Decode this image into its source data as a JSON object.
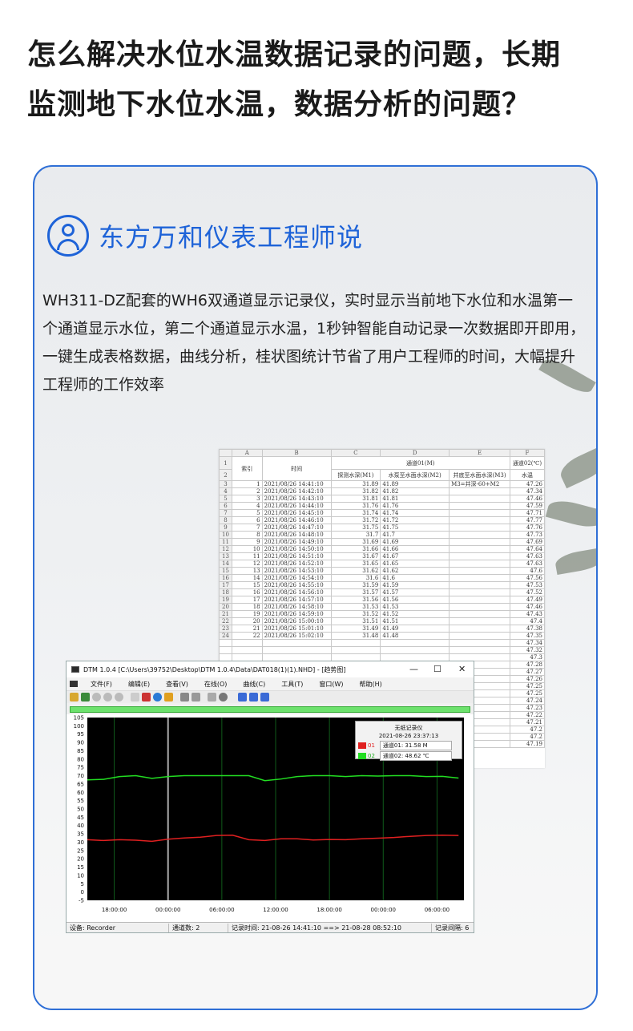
{
  "headline": {
    "line1": "怎么解决水位水温数据记录的问题，长期",
    "line2": "监测地下水位水温，数据分析的问题？"
  },
  "card": {
    "title": "东方万和仪表工程师说",
    "body": "WH311-DZ配套的WH6双通道显示记录仪，实时显示当前地下水位和水温第一个通道显示水位，第二个通道显示水温，1秒钟智能自动记录一次数据即开即用，一键生成表格数据，曲线分析，桂状图统计节省了用户工程师的时间，大幅提升工程师的工作效率",
    "icon": "person-icon",
    "accent_color": "#1e63d8"
  },
  "spreadsheet": {
    "col_headers": [
      "A",
      "B",
      "C",
      "D",
      "E",
      "F"
    ],
    "header_row1": {
      "index": "索引",
      "time": "时间",
      "ch1": "通道01(M)",
      "ch2": "通道02(℃)"
    },
    "header_row2": {
      "m1": "探测水深(M1)",
      "m2": "水泵至水面水深(M2)",
      "m3": "井底至水面水深(M3)",
      "temp": "水温"
    },
    "formula_note": "M3=井深-60+M2",
    "rows": [
      [
        "1",
        "2021/08/26 14:41:10",
        "31.89",
        "41.89",
        "47.26"
      ],
      [
        "2",
        "2021/08/26 14:42:10",
        "31.82",
        "41.82",
        "47.34"
      ],
      [
        "3",
        "2021/08/26 14:43:10",
        "31.81",
        "41.81",
        "47.46"
      ],
      [
        "4",
        "2021/08/26 14:44:10",
        "31.76",
        "41.76",
        "47.59"
      ],
      [
        "5",
        "2021/08/26 14:45:10",
        "31.74",
        "41.74",
        "47.71"
      ],
      [
        "6",
        "2021/08/26 14:46:10",
        "31.72",
        "41.72",
        "47.77"
      ],
      [
        "7",
        "2021/08/26 14:47:10",
        "31.75",
        "41.75",
        "47.76"
      ],
      [
        "8",
        "2021/08/26 14:48:10",
        "31.7",
        "41.7",
        "47.73"
      ],
      [
        "9",
        "2021/08/26 14:49:10",
        "31.69",
        "41.69",
        "47.69"
      ],
      [
        "10",
        "2021/08/26 14:50:10",
        "31.66",
        "41.66",
        "47.64"
      ],
      [
        "11",
        "2021/08/26 14:51:10",
        "31.67",
        "41.67",
        "47.63"
      ],
      [
        "12",
        "2021/08/26 14:52:10",
        "31.65",
        "41.65",
        "47.63"
      ],
      [
        "13",
        "2021/08/26 14:53:10",
        "31.62",
        "41.62",
        "47.6"
      ],
      [
        "14",
        "2021/08/26 14:54:10",
        "31.6",
        "41.6",
        "47.56"
      ],
      [
        "15",
        "2021/08/26 14:55:10",
        "31.59",
        "41.59",
        "47.53"
      ],
      [
        "16",
        "2021/08/26 14:56:10",
        "31.57",
        "41.57",
        "47.52"
      ],
      [
        "17",
        "2021/08/26 14:57:10",
        "31.56",
        "41.56",
        "47.49"
      ],
      [
        "18",
        "2021/08/26 14:58:10",
        "31.53",
        "41.53",
        "47.46"
      ],
      [
        "19",
        "2021/08/26 14:59:10",
        "31.52",
        "41.52",
        "47.43"
      ],
      [
        "20",
        "2021/08/26 15:00:10",
        "31.51",
        "41.51",
        "47.4"
      ],
      [
        "21",
        "2021/08/26 15:01:10",
        "31.49",
        "41.49",
        "47.38"
      ],
      [
        "22",
        "2021/08/26 15:02:10",
        "31.48",
        "41.48",
        "47.35"
      ]
    ],
    "extra_temps": [
      "47.34",
      "47.32",
      "47.3",
      "47.28",
      "47.27",
      "47.26",
      "47.25",
      "47.25",
      "47.24",
      "47.23",
      "47.22",
      "47.21",
      "47.2",
      "47.2",
      "47.19"
    ]
  },
  "dtm": {
    "title": "DTM 1.0.4 [C:\\Users\\39752\\Desktop\\DTM 1.0.4\\Data\\DAT018(1)(1).NHD] - [趋势图]",
    "menu": [
      "文件(F)",
      "编辑(E)",
      "查看(V)",
      "在线(O)",
      "曲线(C)",
      "工具(T)",
      "窗口(W)",
      "帮助(H)"
    ],
    "legend": {
      "title": "无纸记录仪",
      "datetime": "2021-08-26 23:37:13",
      "ch1_tag": "01",
      "ch1_text": "通道01: 31.58 M",
      "ch2_tag": "02",
      "ch2_text": "通道02: 48.62 ℃"
    },
    "status": {
      "device": "设备: Recorder",
      "channels": "通道数: 2",
      "record_time": "记录时间: 21-08-26 14:41:10 ==> 21-08-28 08:52:10",
      "interval": "记录间隔: 6"
    },
    "colors": {
      "ch1": "#e02020",
      "ch2": "#22dd22",
      "plot_bg": "#000000",
      "grid": "#0f5a1a"
    }
  },
  "chart_data": {
    "type": "line",
    "ylim": [
      -5,
      105
    ],
    "yticks": [
      105,
      100,
      95,
      90,
      85,
      80,
      75,
      70,
      65,
      60,
      55,
      50,
      45,
      40,
      35,
      30,
      25,
      20,
      15,
      10,
      5,
      0,
      -5
    ],
    "xticks": [
      "18:00:00",
      "00:00:00",
      "06:00:00",
      "12:00:00",
      "18:00:00",
      "00:00:00",
      "06:00:00"
    ],
    "x": [
      0,
      0.3,
      0.6,
      0.9,
      1.2,
      1.5,
      1.8,
      2.1,
      2.4,
      2.7,
      3.0,
      3.3,
      3.6,
      3.9,
      4.2,
      4.5,
      4.8,
      5.1,
      5.4,
      5.7,
      6.0,
      6.3,
      6.6,
      6.9
    ],
    "series": [
      {
        "name": "通道01",
        "unit": "M",
        "color": "#e02020",
        "values": [
          31.5,
          31,
          31.5,
          31.2,
          30.5,
          31.8,
          32.5,
          33,
          34,
          34.2,
          31.5,
          31,
          32,
          32,
          31.3,
          31.6,
          31.5,
          32,
          32.4,
          32.8,
          33.5,
          34,
          34.2,
          34
        ]
      },
      {
        "name": "通道02",
        "unit": "℃",
        "color": "#22dd22",
        "values": [
          67.5,
          67.8,
          69.5,
          70,
          68.4,
          69.5,
          70,
          70,
          70,
          70,
          70,
          67,
          68,
          69.5,
          70,
          70,
          69.5,
          70,
          69.8,
          70,
          70,
          69.5,
          69.6,
          68.6
        ]
      }
    ],
    "grid": true,
    "legend_position": "top-right"
  }
}
